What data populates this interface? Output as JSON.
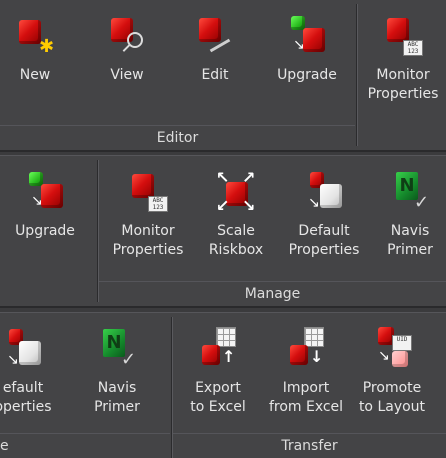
{
  "band1": {
    "editor_label": "Editor",
    "buttons": {
      "new": "New",
      "view": "View",
      "edit": "Edit",
      "upgrade": "Upgrade",
      "monitor_line1": "Monitor",
      "monitor_line2": "Properties"
    },
    "monitor_card": "ABC 123"
  },
  "band2": {
    "manage_label": "Manage",
    "buttons": {
      "upgrade": "Upgrade",
      "monitor_line1": "Monitor",
      "monitor_line2": "Properties",
      "scale_line1": "Scale",
      "scale_line2": "Riskbox",
      "default_line1": "Default",
      "default_line2": "Properties",
      "navis_line1": "Navis",
      "navis_line2": "Primer"
    },
    "monitor_card": "ABC 123"
  },
  "band3": {
    "left_label_fragment": "e",
    "transfer_label": "Transfer",
    "buttons": {
      "default_line1": "efault",
      "default_line2": "operties",
      "navis_line1": "Navis",
      "navis_line2": "Primer",
      "export_line1": "Export",
      "export_line2": "to Excel",
      "import_line1": "Import",
      "import_line2": "from Excel",
      "promote_line1": "Promote",
      "promote_line2": "to Layout"
    },
    "promote_card": "UID"
  },
  "colors": {
    "background": "#444446",
    "text": "#e6e6e6",
    "red": "#d50e0e",
    "green": "#26b81c"
  }
}
